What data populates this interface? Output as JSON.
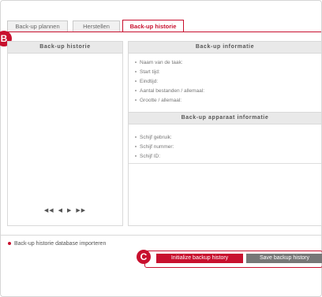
{
  "tabs": [
    {
      "label": "Back-up plannen"
    },
    {
      "label": "Herstellen"
    },
    {
      "label": "Back-up historie"
    }
  ],
  "markers": {
    "b": "B",
    "c": "C"
  },
  "left_panel": {
    "title": "Back-up historie",
    "pager": [
      "◀◀",
      "◀",
      "▶",
      "▶▶"
    ]
  },
  "right_panel": {
    "title": "Back-up informatie",
    "info_items": [
      "Naam van de taak:",
      "Start tijd:",
      "Eindtijd:",
      "Aantal bestanden / allemaal:",
      "Grootte / allemaal:"
    ],
    "device_title": "Back-up apparaat informatie",
    "device_items": [
      "Schijf gebruik:",
      "Schijf nummer:",
      "Schijf ID:"
    ]
  },
  "bottom": {
    "import_label": "Back-up historie database importeren",
    "init_button": "Initialize backup history",
    "save_button": "Save backup history"
  },
  "colors": {
    "accent": "#c8102e",
    "gray_button": "#777777"
  }
}
